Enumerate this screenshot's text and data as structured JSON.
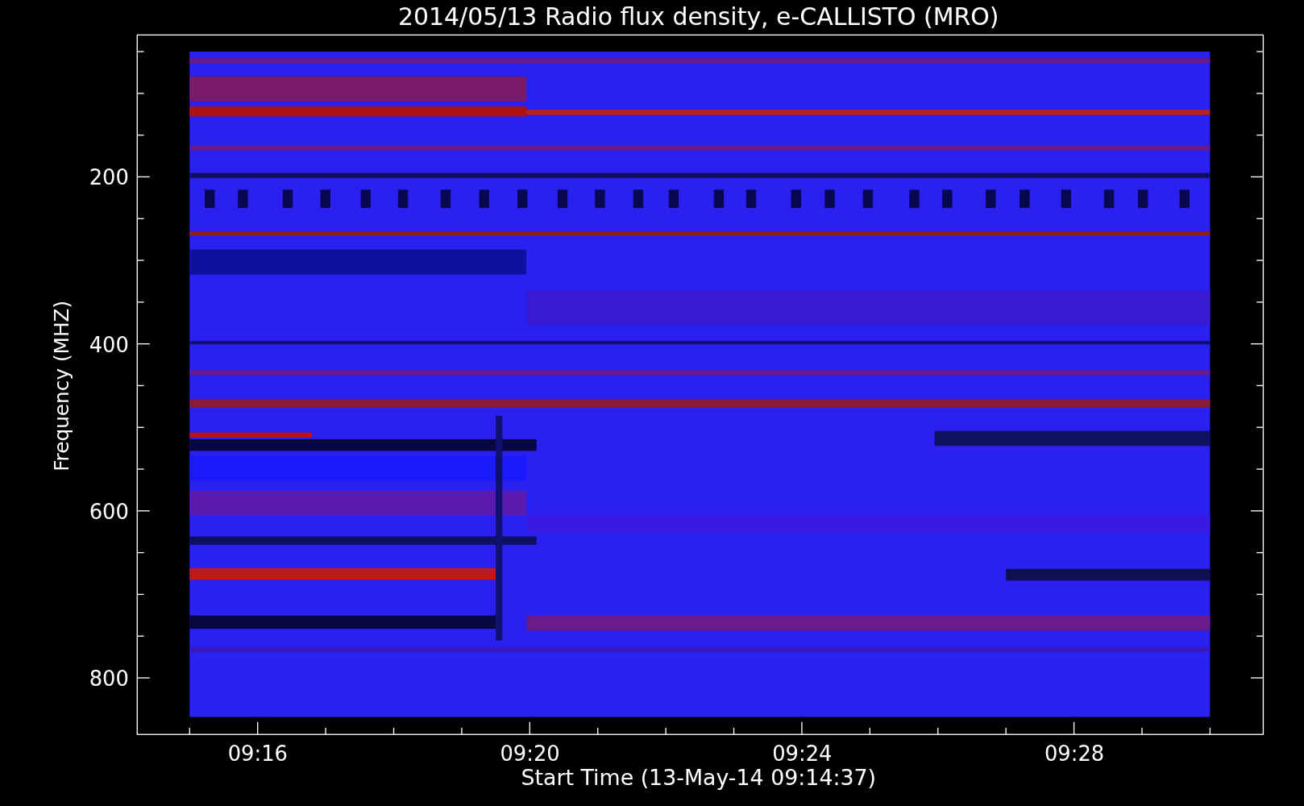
{
  "title": "2014/05/13  Radio flux density, e-CALLISTO (MRO)",
  "y_axis": {
    "label": "Frequency (MHZ)",
    "ticks": [
      "200",
      "400",
      "600",
      "800"
    ]
  },
  "x_axis": {
    "label": "Start Time (13-May-14 09:14:37)",
    "ticks": [
      "09:16",
      "09:20",
      "09:24",
      "09:28"
    ]
  }
}
